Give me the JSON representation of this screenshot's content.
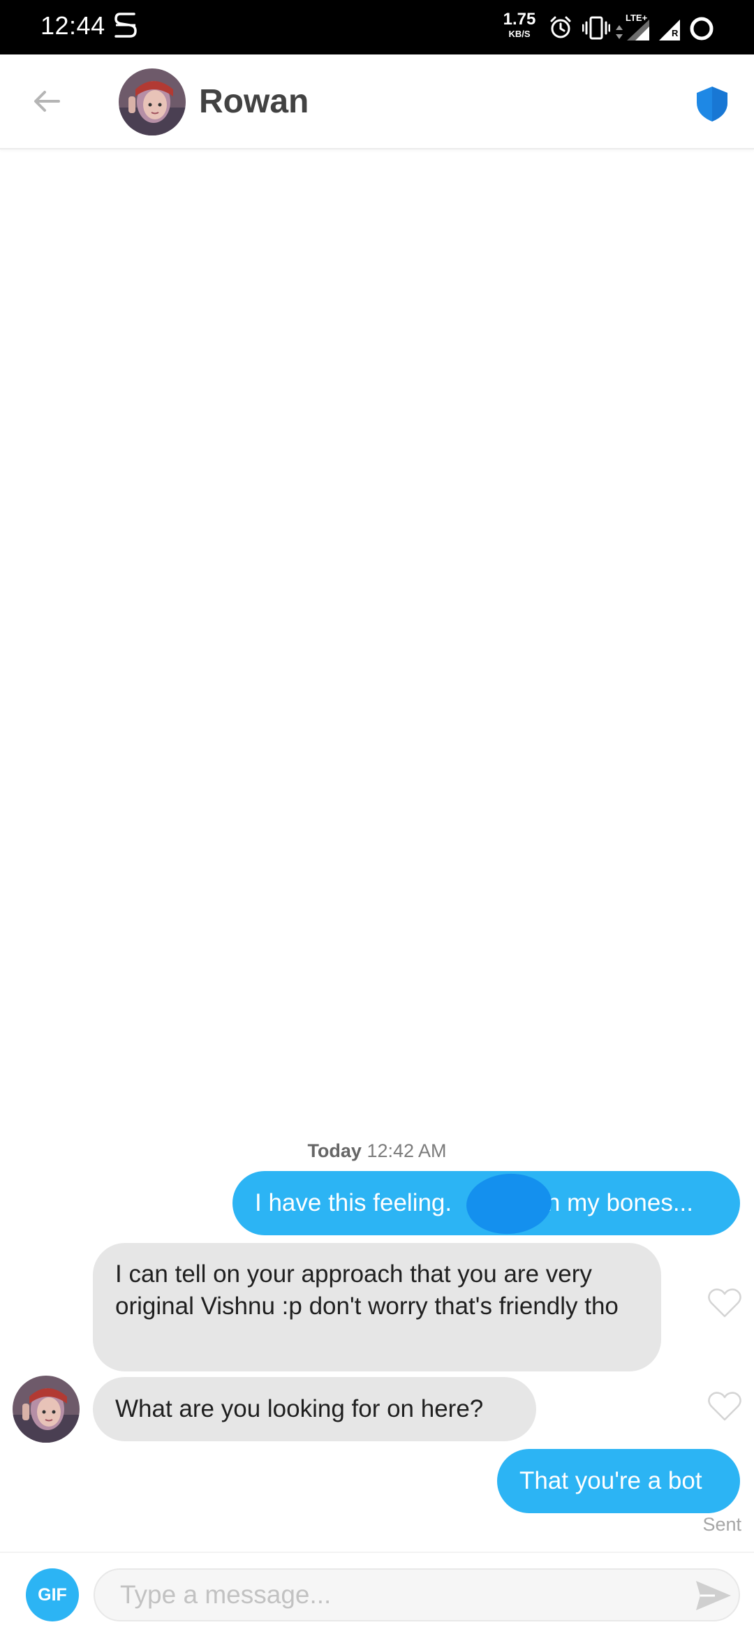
{
  "status_bar": {
    "time": "12:44",
    "net_speed_value": "1.75",
    "net_speed_unit": "KB/S",
    "network_type": "LTE+",
    "roaming_indicator": "R",
    "icons": [
      "s-app-icon",
      "alarm-icon",
      "vibrate-icon",
      "data-arrows-icon",
      "signal-icon",
      "signal-roaming-icon",
      "battery-ring-icon"
    ]
  },
  "header": {
    "contact_name": "Rowan",
    "back_icon": "arrow-left-icon",
    "safety_icon": "shield-icon"
  },
  "chat": {
    "date_day": "Today",
    "date_time": "12:42 AM",
    "messages": [
      {
        "direction": "outgoing",
        "text_before": "I have this feeling.",
        "text_after": "in my bones...",
        "redacted": true
      },
      {
        "direction": "incoming",
        "text": "I can tell on your approach that you are very original Vishnu :p don't worry that's friendly tho",
        "liked": false
      },
      {
        "direction": "incoming",
        "text": "What are you looking for on here?",
        "liked": false
      },
      {
        "direction": "outgoing",
        "text": "That you're a bot"
      }
    ],
    "sent_label": "Sent"
  },
  "composer": {
    "gif_label": "GIF",
    "placeholder": "Type a message...",
    "value": "",
    "send_icon": "send-icon"
  },
  "colors": {
    "accent_blue": "#2cb4f4",
    "shield_blue": "#1e88e5",
    "incoming_bubble": "#e6e6e6",
    "redaction_blue": "#1490ee"
  }
}
